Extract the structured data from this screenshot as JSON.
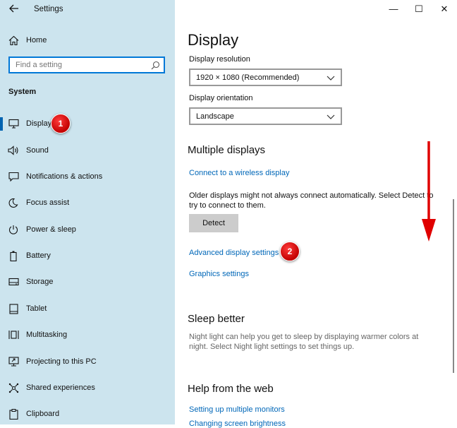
{
  "window": {
    "title": "Settings",
    "minimize_glyph": "—",
    "maximize_glyph": "☐",
    "close_glyph": "✕"
  },
  "sidebar": {
    "home_label": "Home",
    "search_placeholder": "Find a setting",
    "section_label": "System",
    "items": [
      {
        "label": "Display",
        "icon": "monitor-icon",
        "active": true
      },
      {
        "label": "Sound",
        "icon": "speaker-icon"
      },
      {
        "label": "Notifications & actions",
        "icon": "notification-icon"
      },
      {
        "label": "Focus assist",
        "icon": "moon-icon"
      },
      {
        "label": "Power & sleep",
        "icon": "power-icon"
      },
      {
        "label": "Battery",
        "icon": "battery-icon"
      },
      {
        "label": "Storage",
        "icon": "storage-icon"
      },
      {
        "label": "Tablet",
        "icon": "tablet-icon"
      },
      {
        "label": "Multitasking",
        "icon": "multitasking-icon"
      },
      {
        "label": "Projecting to this PC",
        "icon": "projecting-icon"
      },
      {
        "label": "Shared experiences",
        "icon": "shared-icon"
      },
      {
        "label": "Clipboard",
        "icon": "clipboard-icon"
      }
    ]
  },
  "main": {
    "title": "Display",
    "resolution_label": "Display resolution",
    "resolution_value": "1920 × 1080 (Recommended)",
    "orientation_label": "Display orientation",
    "orientation_value": "Landscape",
    "multiple_displays_heading": "Multiple displays",
    "wireless_link": "Connect to a wireless display",
    "older_displays_text": "Older displays might not always connect automatically. Select Detect to try to connect to them.",
    "detect_button": "Detect",
    "advanced_link": "Advanced display settings",
    "graphics_link": "Graphics settings",
    "sleep_heading": "Sleep better",
    "sleep_text": "Night light can help you get to sleep by displaying warmer colors at night. Select Night light settings to set things up.",
    "help_heading": "Help from the web",
    "help_links": [
      "Setting up multiple monitors",
      "Changing screen brightness"
    ]
  },
  "annotations": {
    "badge_1": "1",
    "badge_2": "2",
    "color": "#e00000"
  },
  "colors": {
    "sidebar_bg": "#cce4ee",
    "link": "#0067b8",
    "accent": "#0078d7"
  }
}
